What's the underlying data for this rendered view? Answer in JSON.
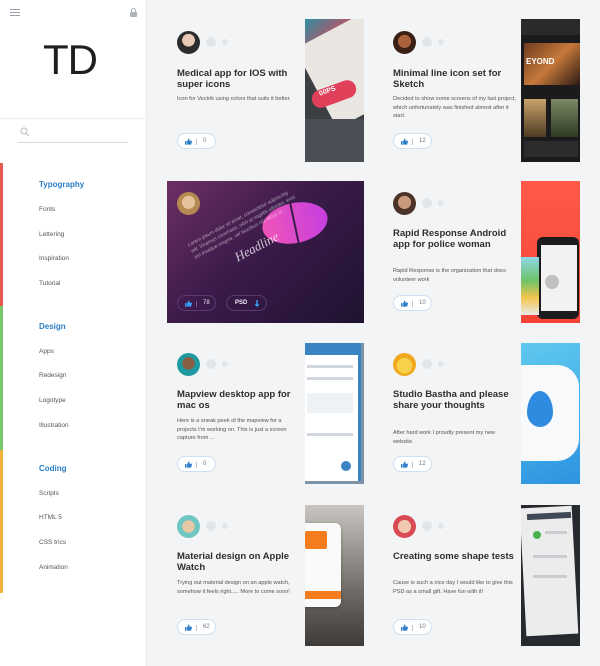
{
  "app": {
    "logo_text": "TD",
    "accent_color": "#2a7fc8"
  },
  "search": {
    "placeholder": "",
    "value": ""
  },
  "nav": {
    "sections": [
      {
        "title": "Typography",
        "color": "#e85a4f",
        "items": [
          "Fonts",
          "Lettering",
          "Inspiration",
          "Tutorial"
        ]
      },
      {
        "title": "Design",
        "color": "#7bc96f",
        "items": [
          "Apps",
          "Redesign",
          "Logotype",
          "Illustration"
        ]
      },
      {
        "title": "Coding",
        "color": "#f2b33d",
        "items": [
          "Scripts",
          "HTML 5",
          "CSS trics",
          "Animation"
        ]
      }
    ]
  },
  "cards": [
    {
      "title": "Medical app for IOS with super icons",
      "description": "Icon for Vectrik using colors that suits it better.",
      "likes": "0",
      "thumb_text": "00PS"
    },
    {
      "title": "Minimal line icon set for Sketch",
      "description": "Decided to show some screens of my last project, which unfortunately was finished almost after it start.",
      "likes": "12",
      "thumb_text": "EYOND"
    },
    {
      "title": "Headline",
      "description": "Lorem ipsum dolor sit amet, consectetur adipiscing elit. Vivamus commodo, nibh at sagittis ultricies, eros est tristique magna, vel faucibus nisi lacus in...",
      "likes": "78",
      "psd_label": "PSD"
    },
    {
      "title": "Rapid Response Android app for police woman",
      "description": "Rapid Response is the organization that does volunteer work",
      "likes": "10"
    },
    {
      "title": "Mapview desktop app for mac os",
      "description": "Here is a sneak peek of the mapview for a projects I'm working on. This is just a screen capture from ...",
      "likes": "0"
    },
    {
      "title": "Studio Bastha and please share your thoughts",
      "description": "After hard work I proudly present my new website.",
      "likes": "12"
    },
    {
      "title": "Material design on Apple Watch",
      "description": "Trying out material design on an apple watch, somehow it feels right..... More to come soon!",
      "likes": "62"
    },
    {
      "title": "Creating some shape tests",
      "description": "Cause is such a nice day I would like to give this PSD as a small gift. Have fun with it!",
      "likes": "10"
    }
  ]
}
